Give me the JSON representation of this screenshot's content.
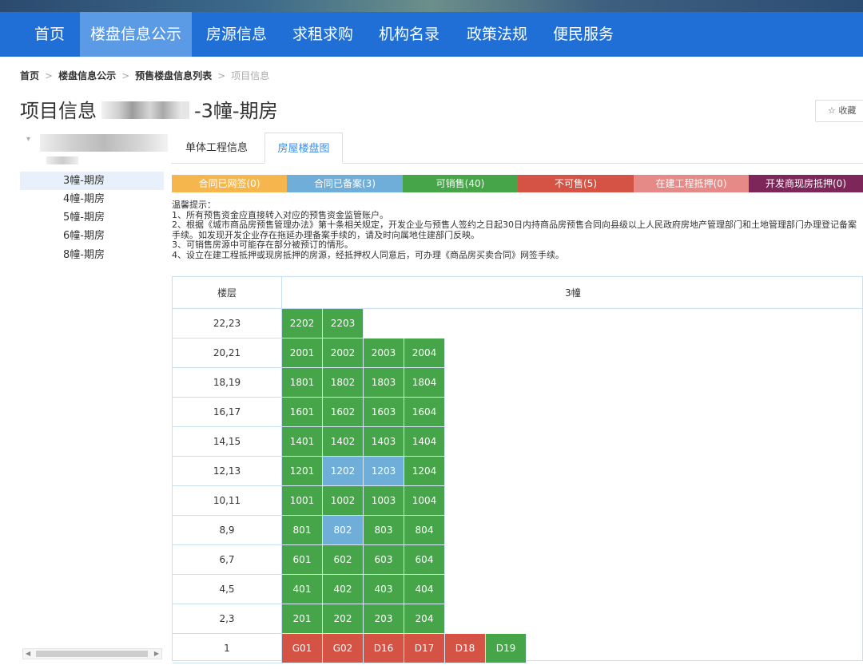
{
  "nav": {
    "items": [
      "首页",
      "楼盘信息公示",
      "房源信息",
      "求租求购",
      "机构名录",
      "政策法规",
      "便民服务"
    ],
    "active_index": 1
  },
  "breadcrumb": {
    "items": [
      "首页",
      "楼盘信息公示",
      "预售楼盘信息列表"
    ],
    "current": "项目信息"
  },
  "title": {
    "prefix": "项目信息",
    "suffix": "-3幢-期房"
  },
  "collect_label": "收藏",
  "tree": {
    "items": [
      "3幢-期房",
      "4幢-期房",
      "5幢-期房",
      "6幢-期房",
      "8幢-期房"
    ],
    "selected_index": 0
  },
  "tabs": {
    "items": [
      "单体工程信息",
      "房屋楼盘图"
    ],
    "active_index": 1
  },
  "legend": [
    {
      "label": "合同已网签(0)",
      "color": "#f5b74d"
    },
    {
      "label": "合同已备案(3)",
      "color": "#6eaed8"
    },
    {
      "label": "可销售(40)",
      "color": "#46a549"
    },
    {
      "label": "不可售(5)",
      "color": "#d55345"
    },
    {
      "label": "在建工程抵押(0)",
      "color": "#e58a86"
    },
    {
      "label": "开发商现房抵押(0)",
      "color": "#7d2659"
    }
  ],
  "notes": {
    "heading": "温馨提示：",
    "lines": [
      "1、所有预售资金应直接转入对应的预售资金监管账户。",
      "2、根据《城市商品房预售管理办法》第十条相关规定，开发企业与预售人签约之日起30日内持商品房预售合同向县级以上人民政府房地产管理部门和土地管理部门办理登记备案手续。如发现开发企业存在拖延办理备案手续的，请及时向属地住建部门反映。",
      "3、可销售房源中可能存在部分被预订的情形。",
      "4、设立在建工程抵押或现房抵押的房源，经抵押权人同意后，可办理《商品房买卖合同》网签手续。"
    ]
  },
  "grid": {
    "floor_header": "楼层",
    "building_header": "3幢",
    "status_colors": {
      "available": "#46a549",
      "filed": "#6eaed8",
      "unavailable": "#d55345"
    },
    "rows": [
      {
        "floor": "22,23",
        "rooms": [
          {
            "no": "2202",
            "status": "available"
          },
          {
            "no": "2203",
            "status": "available"
          }
        ]
      },
      {
        "floor": "20,21",
        "rooms": [
          {
            "no": "2001",
            "status": "available"
          },
          {
            "no": "2002",
            "status": "available"
          },
          {
            "no": "2003",
            "status": "available"
          },
          {
            "no": "2004",
            "status": "available"
          }
        ]
      },
      {
        "floor": "18,19",
        "rooms": [
          {
            "no": "1801",
            "status": "available"
          },
          {
            "no": "1802",
            "status": "available"
          },
          {
            "no": "1803",
            "status": "available"
          },
          {
            "no": "1804",
            "status": "available"
          }
        ]
      },
      {
        "floor": "16,17",
        "rooms": [
          {
            "no": "1601",
            "status": "available"
          },
          {
            "no": "1602",
            "status": "available"
          },
          {
            "no": "1603",
            "status": "available"
          },
          {
            "no": "1604",
            "status": "available"
          }
        ]
      },
      {
        "floor": "14,15",
        "rooms": [
          {
            "no": "1401",
            "status": "available"
          },
          {
            "no": "1402",
            "status": "available"
          },
          {
            "no": "1403",
            "status": "available"
          },
          {
            "no": "1404",
            "status": "available"
          }
        ]
      },
      {
        "floor": "12,13",
        "rooms": [
          {
            "no": "1201",
            "status": "available"
          },
          {
            "no": "1202",
            "status": "filed"
          },
          {
            "no": "1203",
            "status": "filed"
          },
          {
            "no": "1204",
            "status": "available"
          }
        ]
      },
      {
        "floor": "10,11",
        "rooms": [
          {
            "no": "1001",
            "status": "available"
          },
          {
            "no": "1002",
            "status": "available"
          },
          {
            "no": "1003",
            "status": "available"
          },
          {
            "no": "1004",
            "status": "available"
          }
        ]
      },
      {
        "floor": "8,9",
        "rooms": [
          {
            "no": "801",
            "status": "available"
          },
          {
            "no": "802",
            "status": "filed"
          },
          {
            "no": "803",
            "status": "available"
          },
          {
            "no": "804",
            "status": "available"
          }
        ]
      },
      {
        "floor": "6,7",
        "rooms": [
          {
            "no": "601",
            "status": "available"
          },
          {
            "no": "602",
            "status": "available"
          },
          {
            "no": "603",
            "status": "available"
          },
          {
            "no": "604",
            "status": "available"
          }
        ]
      },
      {
        "floor": "4,5",
        "rooms": [
          {
            "no": "401",
            "status": "available"
          },
          {
            "no": "402",
            "status": "available"
          },
          {
            "no": "403",
            "status": "available"
          },
          {
            "no": "404",
            "status": "available"
          }
        ]
      },
      {
        "floor": "2,3",
        "rooms": [
          {
            "no": "201",
            "status": "available"
          },
          {
            "no": "202",
            "status": "available"
          },
          {
            "no": "203",
            "status": "available"
          },
          {
            "no": "204",
            "status": "available"
          }
        ]
      },
      {
        "floor": "1",
        "rooms": [
          {
            "no": "G01",
            "status": "unavailable"
          },
          {
            "no": "G02",
            "status": "unavailable"
          },
          {
            "no": "D16",
            "status": "unavailable"
          },
          {
            "no": "D17",
            "status": "unavailable"
          },
          {
            "no": "D18",
            "status": "unavailable"
          },
          {
            "no": "D19",
            "status": "available"
          }
        ]
      }
    ]
  }
}
